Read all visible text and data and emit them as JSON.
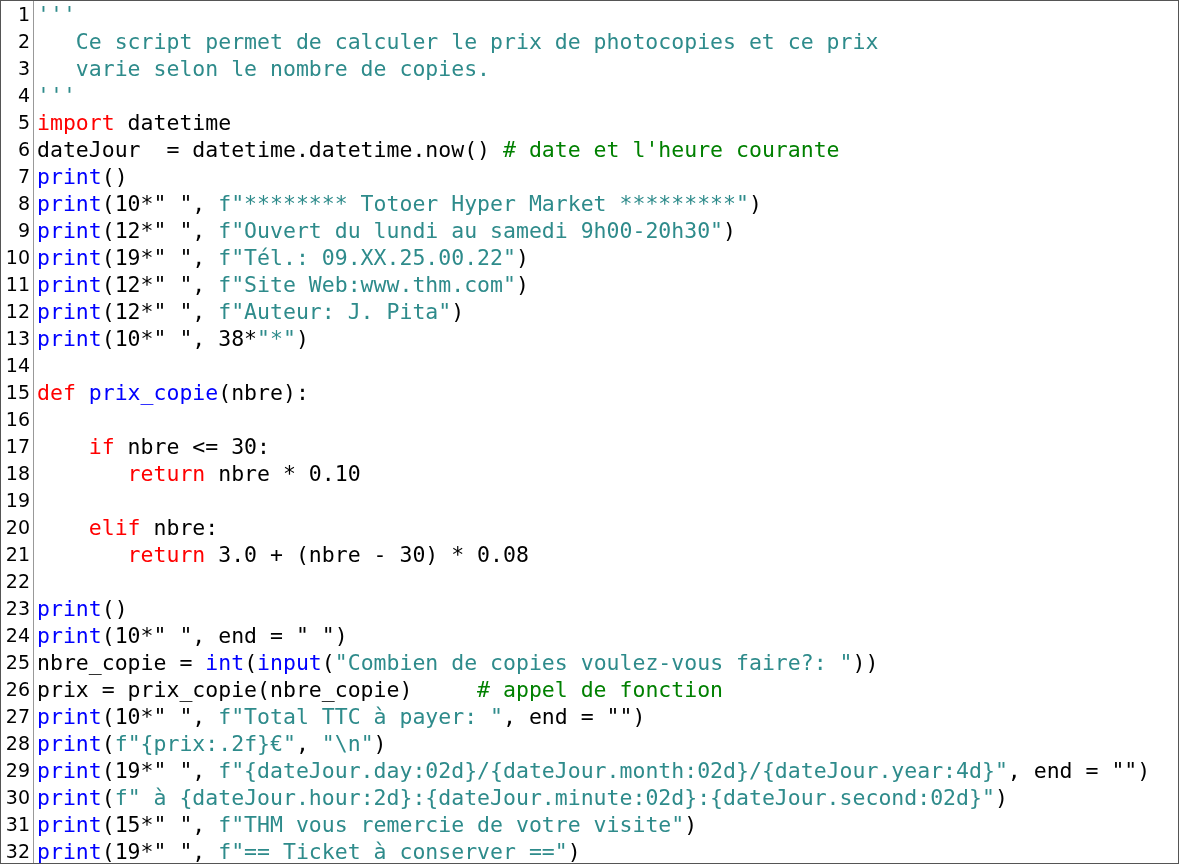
{
  "editor": {
    "lines": [
      {
        "number": "1",
        "tokens": [
          {
            "kind": "string",
            "text": "'''"
          }
        ]
      },
      {
        "number": "2",
        "tokens": [
          {
            "kind": "string",
            "text": "   Ce script permet de calculer le prix de photocopies et ce prix"
          }
        ]
      },
      {
        "number": "3",
        "tokens": [
          {
            "kind": "string",
            "text": "   varie selon le nombre de copies."
          }
        ]
      },
      {
        "number": "4",
        "tokens": [
          {
            "kind": "string",
            "text": "'''"
          }
        ]
      },
      {
        "number": "5",
        "tokens": [
          {
            "kind": "keyword",
            "text": "import"
          },
          {
            "kind": "plain",
            "text": " datetime"
          }
        ]
      },
      {
        "number": "6",
        "tokens": [
          {
            "kind": "plain",
            "text": "dateJour  = datetime.datetime.now() "
          },
          {
            "kind": "comment",
            "text": "# date et l'heure courante"
          }
        ]
      },
      {
        "number": "7",
        "tokens": [
          {
            "kind": "builtin",
            "text": "print"
          },
          {
            "kind": "plain",
            "text": "()"
          }
        ]
      },
      {
        "number": "8",
        "tokens": [
          {
            "kind": "builtin",
            "text": "print"
          },
          {
            "kind": "plain",
            "text": "(10*\" \", "
          },
          {
            "kind": "string",
            "text": "f\"******** Totoer Hyper Market *********\""
          },
          {
            "kind": "plain",
            "text": ")"
          }
        ]
      },
      {
        "number": "9",
        "tokens": [
          {
            "kind": "builtin",
            "text": "print"
          },
          {
            "kind": "plain",
            "text": "(12*\" \", "
          },
          {
            "kind": "string",
            "text": "f\"Ouvert du lundi au samedi 9h00-20h30\""
          },
          {
            "kind": "plain",
            "text": ")"
          }
        ]
      },
      {
        "number": "10",
        "tokens": [
          {
            "kind": "builtin",
            "text": "print"
          },
          {
            "kind": "plain",
            "text": "(19*\" \", "
          },
          {
            "kind": "string",
            "text": "f\"Tél.: 09.XX.25.00.22\""
          },
          {
            "kind": "plain",
            "text": ")"
          }
        ]
      },
      {
        "number": "11",
        "tokens": [
          {
            "kind": "builtin",
            "text": "print"
          },
          {
            "kind": "plain",
            "text": "(12*\" \", "
          },
          {
            "kind": "string",
            "text": "f\"Site Web:www.thm.com\""
          },
          {
            "kind": "plain",
            "text": ")"
          }
        ]
      },
      {
        "number": "12",
        "tokens": [
          {
            "kind": "builtin",
            "text": "print"
          },
          {
            "kind": "plain",
            "text": "(12*\" \", "
          },
          {
            "kind": "string",
            "text": "f\"Auteur: J. Pita\""
          },
          {
            "kind": "plain",
            "text": ")"
          }
        ]
      },
      {
        "number": "13",
        "tokens": [
          {
            "kind": "builtin",
            "text": "print"
          },
          {
            "kind": "plain",
            "text": "(10*\" \", 38*"
          },
          {
            "kind": "string",
            "text": "\"*\""
          },
          {
            "kind": "plain",
            "text": ")"
          }
        ]
      },
      {
        "number": "14"
      },
      {
        "number": "15",
        "tokens": [
          {
            "kind": "keyword",
            "text": "def "
          },
          {
            "kind": "builtin",
            "text": "prix_copie"
          },
          {
            "kind": "plain",
            "text": "(nbre):"
          }
        ]
      },
      {
        "number": "16"
      },
      {
        "number": "17",
        "tokens": [
          {
            "kind": "keyword",
            "text": "    if"
          },
          {
            "kind": "plain",
            "text": " nbre <= 30:"
          }
        ]
      },
      {
        "number": "18",
        "tokens": [
          {
            "kind": "keyword",
            "text": "       return"
          },
          {
            "kind": "plain",
            "text": " nbre * 0.10"
          }
        ]
      },
      {
        "number": "19"
      },
      {
        "number": "20",
        "tokens": [
          {
            "kind": "keyword",
            "text": "    elif"
          },
          {
            "kind": "plain",
            "text": " nbre:"
          }
        ]
      },
      {
        "number": "21",
        "tokens": [
          {
            "kind": "keyword",
            "text": "       return"
          },
          {
            "kind": "plain",
            "text": " 3.0 + (nbre - 30) * 0.08"
          }
        ]
      },
      {
        "number": "22"
      },
      {
        "number": "23",
        "tokens": [
          {
            "kind": "builtin",
            "text": "print"
          },
          {
            "kind": "plain",
            "text": "()"
          }
        ]
      },
      {
        "number": "24",
        "tokens": [
          {
            "kind": "builtin",
            "text": "print"
          },
          {
            "kind": "plain",
            "text": "(10*\" \", end = \" \")"
          }
        ]
      },
      {
        "number": "25",
        "tokens": [
          {
            "kind": "plain",
            "text": "nbre_copie = "
          },
          {
            "kind": "builtin",
            "text": "int"
          },
          {
            "kind": "plain",
            "text": "("
          },
          {
            "kind": "builtin",
            "text": "input"
          },
          {
            "kind": "plain",
            "text": "("
          },
          {
            "kind": "string",
            "text": "\"Combien de copies voulez-vous faire?: \""
          },
          {
            "kind": "plain",
            "text": "))"
          }
        ]
      },
      {
        "number": "26",
        "tokens": [
          {
            "kind": "plain",
            "text": "prix = prix_copie(nbre_copie)     "
          },
          {
            "kind": "comment",
            "text": "# appel de fonction"
          }
        ]
      },
      {
        "number": "27",
        "tokens": [
          {
            "kind": "builtin",
            "text": "print"
          },
          {
            "kind": "plain",
            "text": "(10*\" \", "
          },
          {
            "kind": "string",
            "text": "f\"Total TTC à payer: \""
          },
          {
            "kind": "plain",
            "text": ", end = \"\")"
          }
        ]
      },
      {
        "number": "28",
        "tokens": [
          {
            "kind": "builtin",
            "text": "print"
          },
          {
            "kind": "plain",
            "text": "("
          },
          {
            "kind": "string",
            "text": "f\"{prix:.2f}€\""
          },
          {
            "kind": "plain",
            "text": ", "
          },
          {
            "kind": "string",
            "text": "\"\\n\""
          },
          {
            "kind": "plain",
            "text": ")"
          }
        ]
      },
      {
        "number": "29",
        "tokens": [
          {
            "kind": "builtin",
            "text": "print"
          },
          {
            "kind": "plain",
            "text": "(19*\" \", "
          },
          {
            "kind": "string",
            "text": "f\"{dateJour.day:02d}/{dateJour.month:02d}/{dateJour.year:4d}\""
          },
          {
            "kind": "plain",
            "text": ", end = \"\")"
          }
        ]
      },
      {
        "number": "30",
        "tokens": [
          {
            "kind": "builtin",
            "text": "print"
          },
          {
            "kind": "plain",
            "text": "("
          },
          {
            "kind": "string",
            "text": "f\" à {dateJour.hour:2d}:{dateJour.minute:02d}:{dateJour.second:02d}\""
          },
          {
            "kind": "plain",
            "text": ")"
          }
        ]
      },
      {
        "number": "31",
        "tokens": [
          {
            "kind": "builtin",
            "text": "print"
          },
          {
            "kind": "plain",
            "text": "(15*\" \", "
          },
          {
            "kind": "string",
            "text": "f\"THM vous remercie de votre visite\""
          },
          {
            "kind": "plain",
            "text": ")"
          }
        ]
      },
      {
        "number": "32",
        "tokens": [
          {
            "kind": "builtin",
            "text": "print"
          },
          {
            "kind": "plain",
            "text": "(19*\" \", "
          },
          {
            "kind": "string",
            "text": "f\"== Ticket à conserver ==\""
          },
          {
            "kind": "plain",
            "text": ")"
          }
        ]
      }
    ]
  }
}
